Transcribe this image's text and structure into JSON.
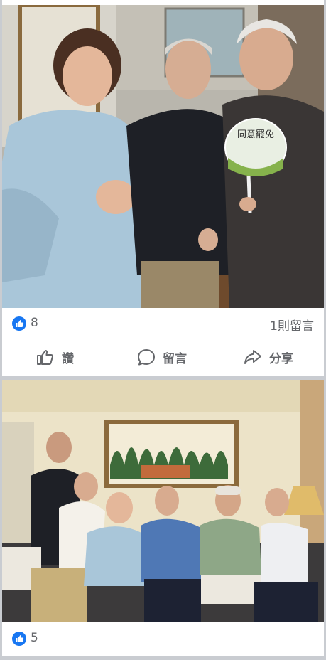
{
  "posts": [
    {
      "reaction_count": "8",
      "comments_label": "1則留言",
      "actions": {
        "like": "讚",
        "comment": "留言",
        "share": "分享"
      },
      "fan_text": "同意罷免"
    },
    {
      "reaction_count": "5"
    }
  ],
  "colors": {
    "like_blue": "#1877f2",
    "feed_bg": "#c9ccd1",
    "text_gray": "#65676b"
  }
}
